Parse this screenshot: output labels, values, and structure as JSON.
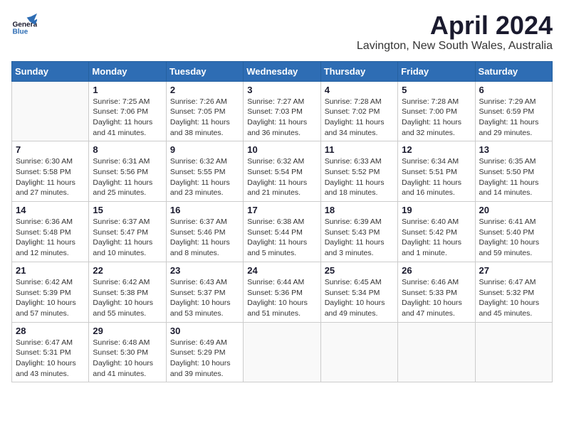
{
  "header": {
    "logo_line1": "General",
    "logo_line2": "Blue",
    "month": "April 2024",
    "location": "Lavington, New South Wales, Australia"
  },
  "days_of_week": [
    "Sunday",
    "Monday",
    "Tuesday",
    "Wednesday",
    "Thursday",
    "Friday",
    "Saturday"
  ],
  "weeks": [
    [
      {
        "day": "",
        "info": ""
      },
      {
        "day": "1",
        "info": "Sunrise: 7:25 AM\nSunset: 7:06 PM\nDaylight: 11 hours\nand 41 minutes."
      },
      {
        "day": "2",
        "info": "Sunrise: 7:26 AM\nSunset: 7:05 PM\nDaylight: 11 hours\nand 38 minutes."
      },
      {
        "day": "3",
        "info": "Sunrise: 7:27 AM\nSunset: 7:03 PM\nDaylight: 11 hours\nand 36 minutes."
      },
      {
        "day": "4",
        "info": "Sunrise: 7:28 AM\nSunset: 7:02 PM\nDaylight: 11 hours\nand 34 minutes."
      },
      {
        "day": "5",
        "info": "Sunrise: 7:28 AM\nSunset: 7:00 PM\nDaylight: 11 hours\nand 32 minutes."
      },
      {
        "day": "6",
        "info": "Sunrise: 7:29 AM\nSunset: 6:59 PM\nDaylight: 11 hours\nand 29 minutes."
      }
    ],
    [
      {
        "day": "7",
        "info": "Sunrise: 6:30 AM\nSunset: 5:58 PM\nDaylight: 11 hours\nand 27 minutes."
      },
      {
        "day": "8",
        "info": "Sunrise: 6:31 AM\nSunset: 5:56 PM\nDaylight: 11 hours\nand 25 minutes."
      },
      {
        "day": "9",
        "info": "Sunrise: 6:32 AM\nSunset: 5:55 PM\nDaylight: 11 hours\nand 23 minutes."
      },
      {
        "day": "10",
        "info": "Sunrise: 6:32 AM\nSunset: 5:54 PM\nDaylight: 11 hours\nand 21 minutes."
      },
      {
        "day": "11",
        "info": "Sunrise: 6:33 AM\nSunset: 5:52 PM\nDaylight: 11 hours\nand 18 minutes."
      },
      {
        "day": "12",
        "info": "Sunrise: 6:34 AM\nSunset: 5:51 PM\nDaylight: 11 hours\nand 16 minutes."
      },
      {
        "day": "13",
        "info": "Sunrise: 6:35 AM\nSunset: 5:50 PM\nDaylight: 11 hours\nand 14 minutes."
      }
    ],
    [
      {
        "day": "14",
        "info": "Sunrise: 6:36 AM\nSunset: 5:48 PM\nDaylight: 11 hours\nand 12 minutes."
      },
      {
        "day": "15",
        "info": "Sunrise: 6:37 AM\nSunset: 5:47 PM\nDaylight: 11 hours\nand 10 minutes."
      },
      {
        "day": "16",
        "info": "Sunrise: 6:37 AM\nSunset: 5:46 PM\nDaylight: 11 hours\nand 8 minutes."
      },
      {
        "day": "17",
        "info": "Sunrise: 6:38 AM\nSunset: 5:44 PM\nDaylight: 11 hours\nand 5 minutes."
      },
      {
        "day": "18",
        "info": "Sunrise: 6:39 AM\nSunset: 5:43 PM\nDaylight: 11 hours\nand 3 minutes."
      },
      {
        "day": "19",
        "info": "Sunrise: 6:40 AM\nSunset: 5:42 PM\nDaylight: 11 hours\nand 1 minute."
      },
      {
        "day": "20",
        "info": "Sunrise: 6:41 AM\nSunset: 5:40 PM\nDaylight: 10 hours\nand 59 minutes."
      }
    ],
    [
      {
        "day": "21",
        "info": "Sunrise: 6:42 AM\nSunset: 5:39 PM\nDaylight: 10 hours\nand 57 minutes."
      },
      {
        "day": "22",
        "info": "Sunrise: 6:42 AM\nSunset: 5:38 PM\nDaylight: 10 hours\nand 55 minutes."
      },
      {
        "day": "23",
        "info": "Sunrise: 6:43 AM\nSunset: 5:37 PM\nDaylight: 10 hours\nand 53 minutes."
      },
      {
        "day": "24",
        "info": "Sunrise: 6:44 AM\nSunset: 5:36 PM\nDaylight: 10 hours\nand 51 minutes."
      },
      {
        "day": "25",
        "info": "Sunrise: 6:45 AM\nSunset: 5:34 PM\nDaylight: 10 hours\nand 49 minutes."
      },
      {
        "day": "26",
        "info": "Sunrise: 6:46 AM\nSunset: 5:33 PM\nDaylight: 10 hours\nand 47 minutes."
      },
      {
        "day": "27",
        "info": "Sunrise: 6:47 AM\nSunset: 5:32 PM\nDaylight: 10 hours\nand 45 minutes."
      }
    ],
    [
      {
        "day": "28",
        "info": "Sunrise: 6:47 AM\nSunset: 5:31 PM\nDaylight: 10 hours\nand 43 minutes."
      },
      {
        "day": "29",
        "info": "Sunrise: 6:48 AM\nSunset: 5:30 PM\nDaylight: 10 hours\nand 41 minutes."
      },
      {
        "day": "30",
        "info": "Sunrise: 6:49 AM\nSunset: 5:29 PM\nDaylight: 10 hours\nand 39 minutes."
      },
      {
        "day": "",
        "info": ""
      },
      {
        "day": "",
        "info": ""
      },
      {
        "day": "",
        "info": ""
      },
      {
        "day": "",
        "info": ""
      }
    ]
  ]
}
